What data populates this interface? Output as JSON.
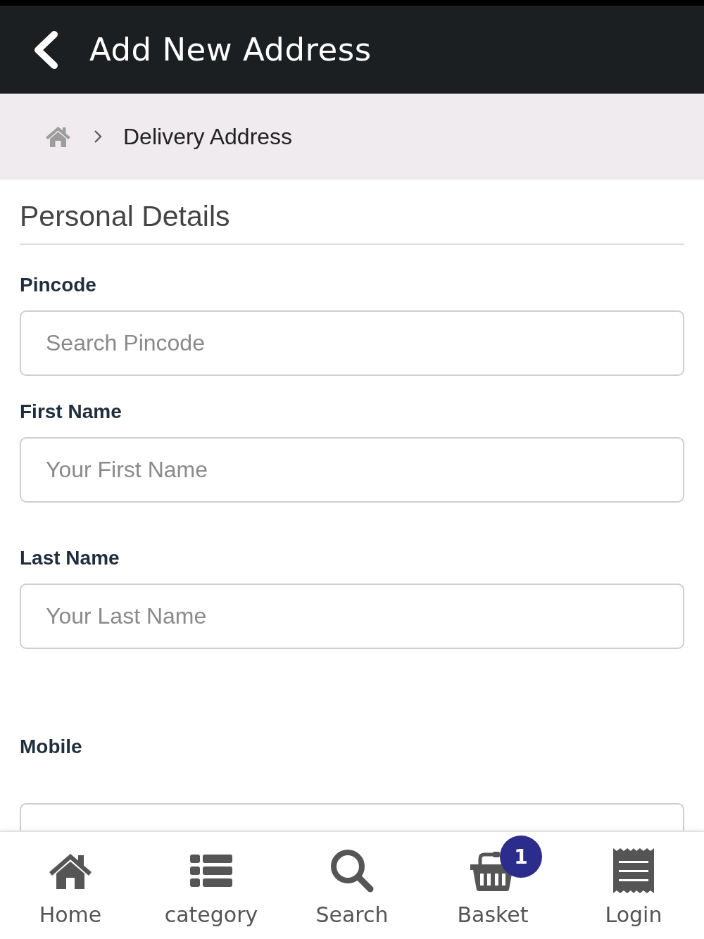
{
  "header": {
    "title": "Add New Address"
  },
  "breadcrumb": {
    "current": "Delivery Address"
  },
  "section": {
    "title": "Personal Details"
  },
  "fields": [
    {
      "label": "Pincode",
      "placeholder": "Search Pincode"
    },
    {
      "label": "First Name",
      "placeholder": "Your First Name"
    },
    {
      "label": "Last Name",
      "placeholder": "Your Last Name"
    },
    {
      "label": "Mobile",
      "cut_off": true
    }
  ],
  "nav": [
    {
      "label": "Home",
      "kind": "home"
    },
    {
      "label": "category",
      "kind": "category"
    },
    {
      "label": "Search",
      "kind": "search"
    },
    {
      "label": "Basket",
      "kind": "basket",
      "badge": "1"
    },
    {
      "label": "Login",
      "kind": "login"
    }
  ]
}
